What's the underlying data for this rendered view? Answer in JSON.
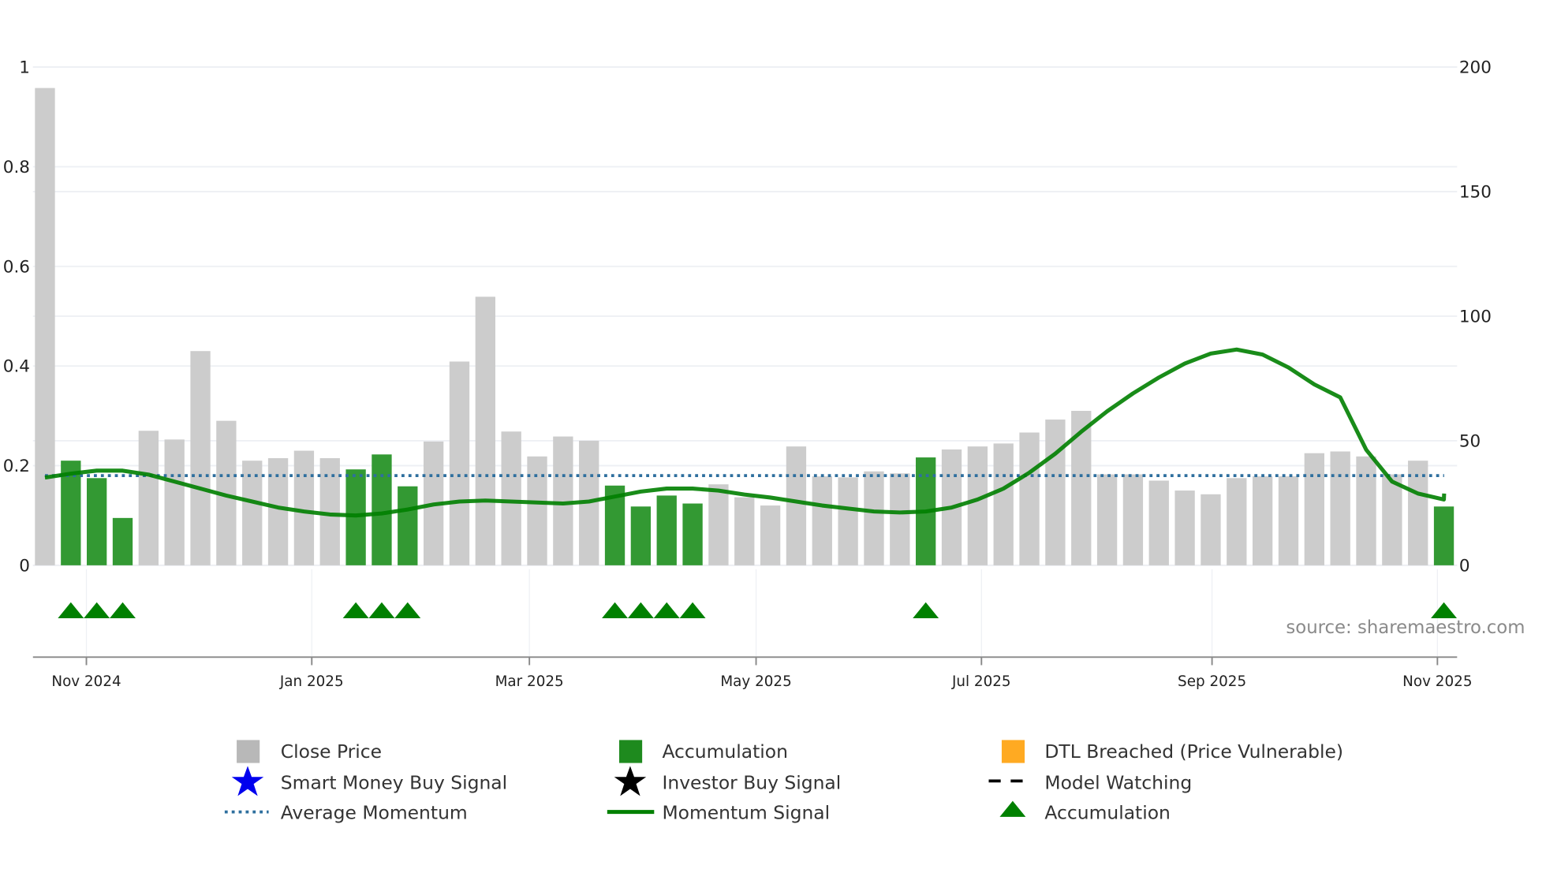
{
  "chart_data": {
    "type": "bar",
    "title": "",
    "source": "source: sharemaestro.com",
    "left_axis": {
      "ticks": [
        "0",
        "0.2",
        "0.4",
        "0.6",
        "0.8",
        "1"
      ],
      "values": [
        0,
        0.2,
        0.4,
        0.6,
        0.8,
        1
      ],
      "range": [
        0,
        1
      ]
    },
    "right_axis": {
      "ticks": [
        "0",
        "50",
        "100",
        "150",
        "200"
      ],
      "values": [
        0,
        50,
        100,
        150,
        200
      ],
      "range": [
        0,
        200
      ]
    },
    "x_ticks": [
      "Nov 2024",
      "Jan 2025",
      "Mar 2025",
      "May 2025",
      "Jul 2025",
      "Sep 2025",
      "Nov 2025"
    ],
    "x_tick_bar_index": [
      1.6,
      10.3,
      18.7,
      27.45,
      36.15,
      45.05,
      53.75
    ],
    "close_price": [
      191.6,
      42,
      35,
      19,
      54,
      50.5,
      86,
      58,
      42,
      43,
      46,
      43,
      38.5,
      44.5,
      31.7,
      49.7,
      81.8,
      107.8,
      53.7,
      43.7,
      51.7,
      50,
      32,
      23.6,
      28,
      24.8,
      32.5,
      27.3,
      24,
      47.7,
      35.7,
      35.3,
      37.7,
      36.9,
      43.3,
      46.5,
      47.7,
      48.9,
      53.3,
      58.5,
      62,
      36.5,
      36.5,
      34,
      30,
      28.5,
      35,
      35.7,
      35.7,
      45,
      45.7,
      43.7,
      36.5,
      42,
      23.6
    ],
    "accumulation_bars": [
      1,
      2,
      3,
      12,
      13,
      14,
      22,
      23,
      24,
      25,
      34,
      54
    ],
    "accumulation_triangles": [
      1,
      2,
      3,
      12,
      13,
      14,
      22,
      23,
      24,
      25,
      34,
      54
    ],
    "momentum_signal": [
      0.176,
      0.184,
      0.19,
      0.19,
      0.182,
      0.168,
      0.154,
      0.14,
      0.128,
      0.116,
      0.108,
      0.102,
      0.1,
      0.104,
      0.112,
      0.122,
      0.128,
      0.13,
      0.128,
      0.126,
      0.124,
      0.128,
      0.138,
      0.148,
      0.154,
      0.154,
      0.15,
      0.142,
      0.136,
      0.128,
      0.12,
      0.114,
      0.108,
      0.106,
      0.108,
      0.116,
      0.132,
      0.154,
      0.186,
      0.224,
      0.268,
      0.309,
      0.345,
      0.377,
      0.405,
      0.425,
      0.433,
      0.423,
      0.397,
      0.363,
      0.337,
      0.232,
      0.168,
      0.144,
      0.132,
      0.144
    ],
    "average_momentum": 0.18,
    "colors": {
      "close": "#cccccc",
      "accumulation": "#339933",
      "momentum": "#008000",
      "average": "#2e6f9e",
      "dtl": "#ffaa22",
      "smart": "#0000ee"
    }
  },
  "legend": [
    {
      "label": "Close Price",
      "icon": "gray-square"
    },
    {
      "label": "Accumulation",
      "icon": "green-square"
    },
    {
      "label": "DTL Breached (Price Vulnerable)",
      "icon": "orange-square"
    },
    {
      "label": "Smart Money Buy Signal",
      "icon": "blue-star"
    },
    {
      "label": "Investor Buy Signal",
      "icon": "black-star"
    },
    {
      "label": "Model Watching",
      "icon": "black-dash"
    },
    {
      "label": "Average Momentum",
      "icon": "blue-dotted-line"
    },
    {
      "label": "Momentum Signal",
      "icon": "green-line"
    },
    {
      "label": "Accumulation",
      "icon": "green-triangle"
    }
  ]
}
